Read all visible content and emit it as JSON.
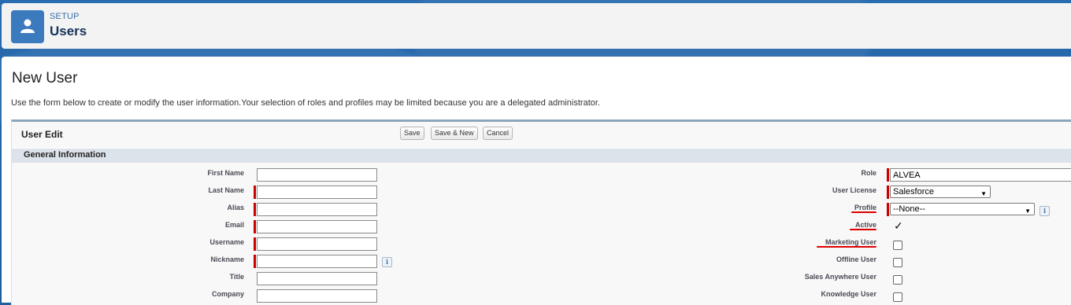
{
  "header": {
    "sub": "SETUP",
    "title": "Users",
    "icon": "user-icon"
  },
  "page": {
    "title": "New User",
    "description": "Use the form below to create or modify the user information.Your selection of roles and profiles may be limited because you are a delegated administrator."
  },
  "edit": {
    "title": "User Edit",
    "buttons": {
      "save": "Save",
      "save_new": "Save & New",
      "cancel": "Cancel"
    },
    "section": "General Information"
  },
  "left_fields": {
    "first_name": {
      "label": "First Name",
      "value": ""
    },
    "last_name": {
      "label": "Last Name",
      "value": ""
    },
    "alias": {
      "label": "Alias",
      "value": ""
    },
    "email": {
      "label": "Email",
      "value": ""
    },
    "username": {
      "label": "Username",
      "value": ""
    },
    "nickname": {
      "label": "Nickname",
      "value": ""
    },
    "title": {
      "label": "Title",
      "value": ""
    },
    "company": {
      "label": "Company",
      "value": ""
    }
  },
  "right_fields": {
    "role": {
      "label": "Role",
      "value": "ALVEA"
    },
    "user_license": {
      "label": "User License",
      "value": "Salesforce"
    },
    "profile": {
      "label": "Profile",
      "value": "--None--"
    },
    "active": {
      "label": "Active",
      "checked": true
    },
    "marketing_user": {
      "label": "Marketing User",
      "checked": false
    },
    "offline_user": {
      "label": "Offline User",
      "checked": false
    },
    "sales_anywhere_user": {
      "label": "Sales Anywhere User",
      "checked": false
    },
    "knowledge_user": {
      "label": "Knowledge User",
      "checked": false
    }
  },
  "annotation_color": "#dd0000"
}
